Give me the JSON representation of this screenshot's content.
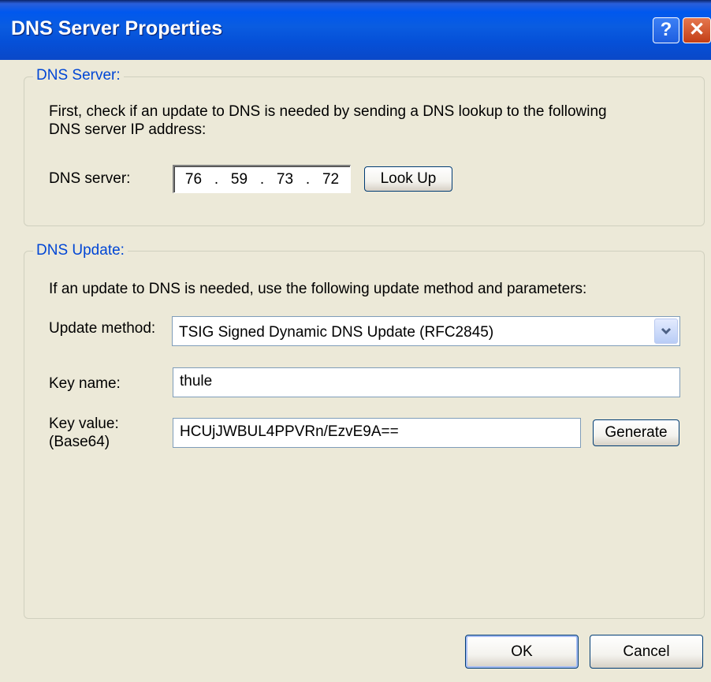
{
  "window": {
    "title": "DNS Server Properties",
    "help_glyph": "?",
    "close_glyph": "✕"
  },
  "dns_server_group": {
    "legend": "DNS Server:",
    "description_line1": "First, check if an update to DNS is needed by sending a DNS lookup to the following",
    "description_line2": "DNS server IP address:",
    "server_label": "DNS server:",
    "ip_octets": [
      "76",
      "59",
      "73",
      "72"
    ],
    "ip_separator": ".",
    "lookup_button": "Look Up"
  },
  "dns_update_group": {
    "legend": "DNS Update:",
    "description": "If an update to DNS is needed, use the following update method and parameters:",
    "method_label": "Update method:",
    "method_value": "TSIG Signed Dynamic DNS Update (RFC2845)",
    "key_name_label": "Key name:",
    "key_name_value": "thule",
    "key_value_label_line1": "Key value:",
    "key_value_label_line2": "(Base64)",
    "key_value": "HCUjJWBUL4PPVRn/EzvE9A==",
    "generate_button": "Generate"
  },
  "footer": {
    "ok_button": "OK",
    "cancel_button": "Cancel"
  },
  "icons": {
    "help": "help-icon",
    "close": "close-icon",
    "dropdown": "chevron-down-icon"
  },
  "colors": {
    "dialog_bg": "#ECE9D8",
    "titlebar_blue": "#0058EE",
    "legend_text": "#0046D5",
    "button_border": "#003C74"
  }
}
